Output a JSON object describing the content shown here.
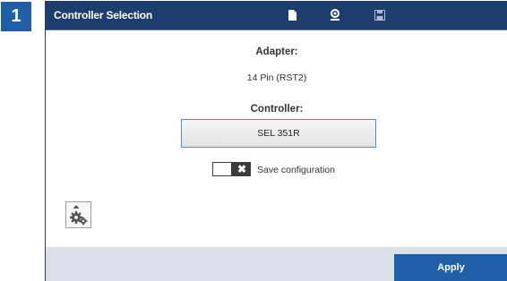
{
  "step_number": "1",
  "window": {
    "title": "Controller Selection",
    "toolbar_icons": [
      "document-icon",
      "person-pin-icon",
      "save-disk-icon"
    ]
  },
  "adapter": {
    "label": "Adapter:",
    "value": "14 Pin (RST2)"
  },
  "controller": {
    "label": "Controller:",
    "selected": "SEL 351R"
  },
  "save_configuration": {
    "label": "Save configuration",
    "enabled": false,
    "off_symbol": "✖"
  },
  "footer": {
    "apply_label": "Apply"
  },
  "colors": {
    "titlebar": "#1d3d6e",
    "step_badge": "#1f5fa8",
    "apply_button": "#1f5fa8",
    "footer_bg": "#dbe1e8",
    "select_border": "#4a90d9",
    "toggle_bg": "#3c3c3c"
  }
}
